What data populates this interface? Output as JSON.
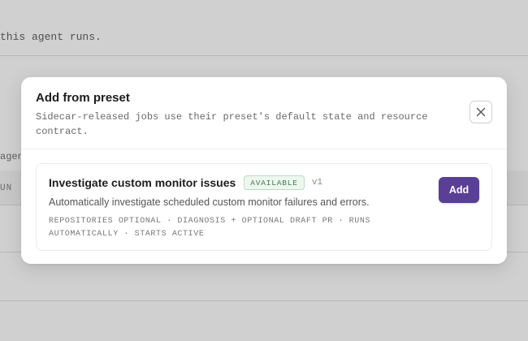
{
  "background": {
    "top_text": "this agent runs.",
    "left_fragment": "agen",
    "column_fragment": "UN"
  },
  "modal": {
    "title": "Add from preset",
    "subtitle": "Sidecar-released jobs use their preset's default state and resource contract.",
    "close_icon": "close-icon",
    "preset": {
      "title": "Investigate custom monitor issues",
      "status": "AVAILABLE",
      "version": "v1",
      "description": "Automatically investigate scheduled custom monitor failures and errors.",
      "meta": "REPOSITORIES OPTIONAL · DIAGNOSIS + OPTIONAL DRAFT PR · RUNS AUTOMATICALLY · STARTS ACTIVE",
      "add_label": "Add"
    }
  },
  "colors": {
    "accent": "#5a3f96",
    "status_text": "#3f7a4f",
    "status_bg": "#eef7ef"
  }
}
